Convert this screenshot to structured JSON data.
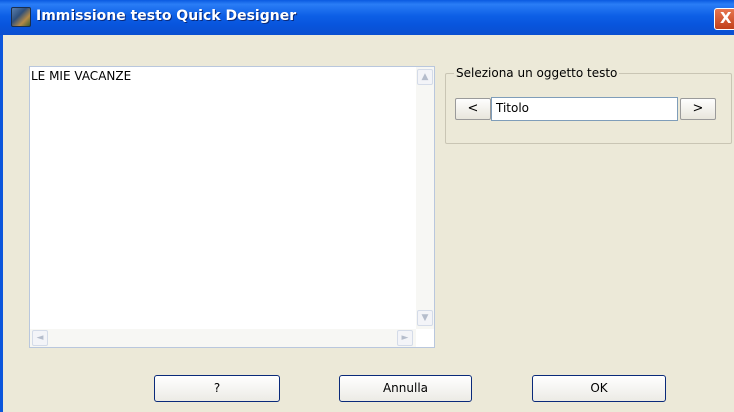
{
  "window": {
    "title": "Immissione testo Quick Designer",
    "close_glyph": "X"
  },
  "editor": {
    "text": "LE MIE VACANZE",
    "scroll_up_glyph": "▲",
    "scroll_down_glyph": "▼",
    "scroll_left_glyph": "◄",
    "scroll_right_glyph": "►"
  },
  "selector": {
    "group_label": "Seleziona un oggetto testo",
    "prev_label": "<",
    "next_label": ">",
    "current_value": "Titolo"
  },
  "buttons": {
    "help_label": "?",
    "cancel_label": "Annulla",
    "ok_label": "OK"
  },
  "icons": {
    "app": "quick-designer-app-icon",
    "close": "close-icon"
  },
  "colors": {
    "titlebar": "#0a55e0",
    "dialog_bg": "#ece9d8",
    "close_button": "#d6532b"
  }
}
